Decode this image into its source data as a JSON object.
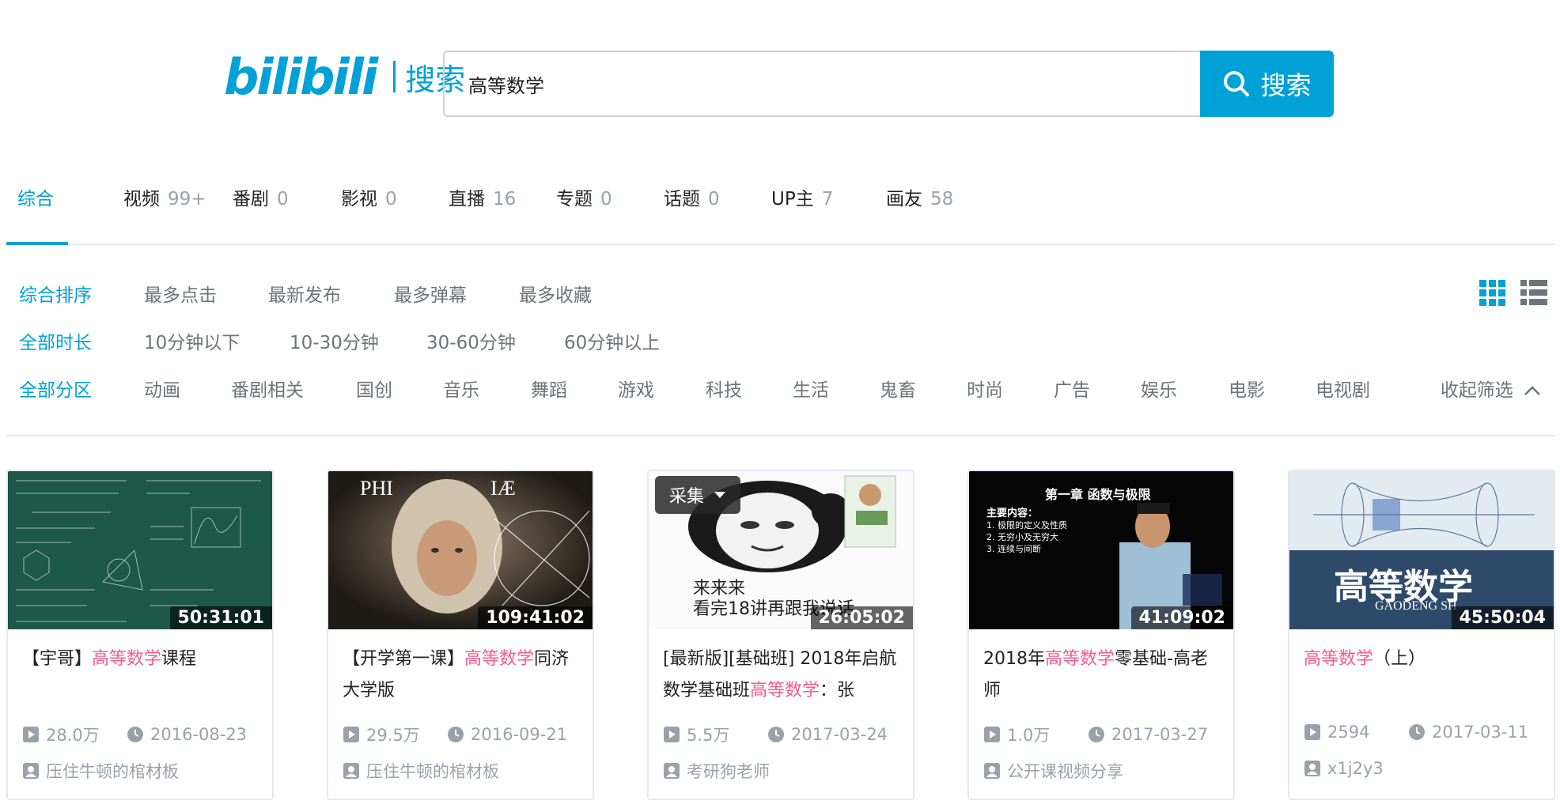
{
  "header": {
    "logo_mark": "bilibili",
    "logo_text": "搜索",
    "search_value": "高等数学",
    "search_button": "搜索"
  },
  "tabs": [
    {
      "label": "综合",
      "count": ""
    },
    {
      "label": "视频",
      "count": "99+"
    },
    {
      "label": "番剧",
      "count": "0"
    },
    {
      "label": "影视",
      "count": "0"
    },
    {
      "label": "直播",
      "count": "16"
    },
    {
      "label": "专题",
      "count": "0"
    },
    {
      "label": "话题",
      "count": "0"
    },
    {
      "label": "UP主",
      "count": "7"
    },
    {
      "label": "画友",
      "count": "58"
    }
  ],
  "filters": {
    "order": [
      "综合排序",
      "最多点击",
      "最新发布",
      "最多弹幕",
      "最多收藏"
    ],
    "duration": [
      "全部时长",
      "10分钟以下",
      "10-30分钟",
      "30-60分钟",
      "60分钟以上"
    ],
    "zone": [
      "全部分区",
      "动画",
      "番剧相关",
      "国创",
      "音乐",
      "舞蹈",
      "游戏",
      "科技",
      "生活",
      "鬼畜",
      "时尚",
      "广告",
      "娱乐",
      "电影",
      "电视剧"
    ],
    "collapse_label": "收起筛选"
  },
  "cards": [
    {
      "duration": "50:31:01",
      "title_pre": "【宇哥】",
      "title_hl": "高等数学",
      "title_post": "课程",
      "plays": "28.0万",
      "date": "2016-08-23",
      "author": "压住牛顿的棺材板"
    },
    {
      "duration": "109:41:02",
      "title_pre": "【开学第一课】",
      "title_hl": "高等数学",
      "title_post": "同济大学版",
      "plays": "29.5万",
      "date": "2016-09-21",
      "author": "压住牛顿的棺材板"
    },
    {
      "duration": "26:05:02",
      "title_pre": "[最新版][基础班] 2018年启航数学基础班",
      "title_hl": "高等数学",
      "title_post": "：张",
      "plays": "5.5万",
      "date": "2017-03-24",
      "author": "考研狗老师",
      "collect": "采集",
      "thumb_text_1": "来来来",
      "thumb_text_2": "看完18讲再跟我说话"
    },
    {
      "duration": "41:09:02",
      "title_pre": "2018年",
      "title_hl": "高等数学",
      "title_post": "零基础-高老师",
      "plays": "1.0万",
      "date": "2017-03-27",
      "author": "公开课视频分享",
      "thumb_title": "第一章  函数与极限",
      "thumb_sub": "主要内容：",
      "thumb_items": [
        "1. 极限的定义及性质",
        "2. 无穷小及无穷大",
        "3. 连续与间断"
      ]
    },
    {
      "duration": "45:50:04",
      "title_pre": "",
      "title_hl": "高等数学",
      "title_post": "（上）",
      "plays": "2594",
      "date": "2017-03-11",
      "author": "x1j2y3",
      "thumb_big": "高等数学",
      "thumb_pinyin": "GAODENG SH"
    }
  ],
  "colors": {
    "accent": "#00a1d6",
    "highlight": "#f25d8e",
    "muted": "#99a2aa"
  }
}
